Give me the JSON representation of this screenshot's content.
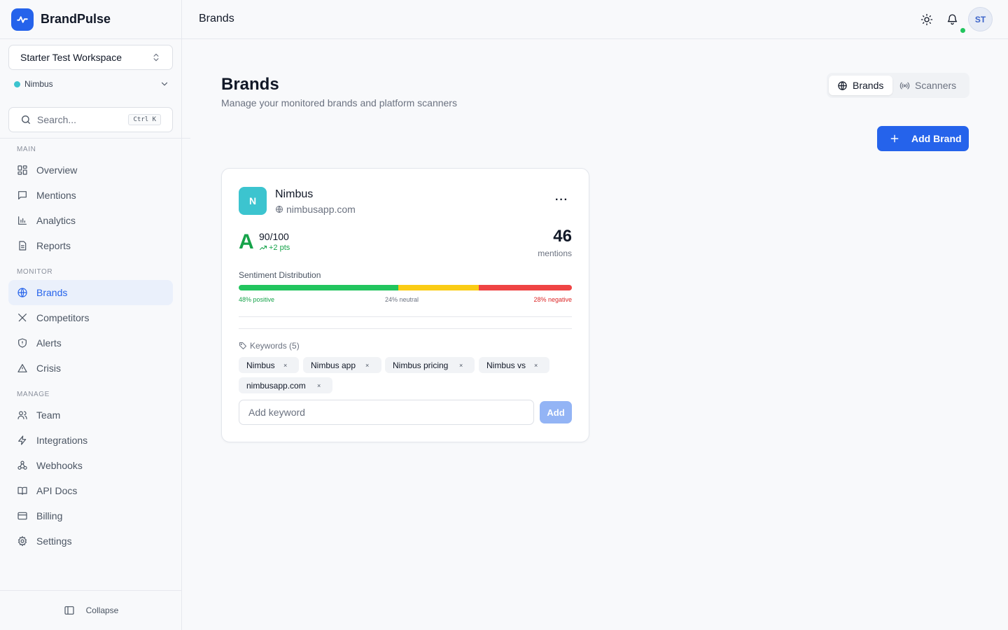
{
  "app": {
    "name": "BrandPulse"
  },
  "workspace": {
    "selected": "Starter Test Workspace"
  },
  "brand_selector": {
    "selected": "Nimbus",
    "dot_color": "#3cc4cf"
  },
  "search": {
    "placeholder": "Search...",
    "shortcut": "Ctrl K"
  },
  "sidebar": {
    "sections": {
      "main": "MAIN",
      "monitor": "MONITOR",
      "manage": "MANAGE"
    },
    "items": {
      "overview": "Overview",
      "mentions": "Mentions",
      "analytics": "Analytics",
      "reports": "Reports",
      "brands": "Brands",
      "competitors": "Competitors",
      "alerts": "Alerts",
      "crisis": "Crisis",
      "team": "Team",
      "integrations": "Integrations",
      "webhooks": "Webhooks",
      "api_docs": "API Docs",
      "billing": "Billing",
      "settings": "Settings"
    },
    "active": "brands",
    "collapse_label": "Collapse"
  },
  "header": {
    "breadcrumb": "Brands",
    "user_initials": "ST"
  },
  "page": {
    "title": "Brands",
    "subtitle": "Manage your monitored brands and platform scanners",
    "tabs": {
      "brands": "Brands",
      "scanners": "Scanners"
    },
    "add_brand_label": "Add Brand"
  },
  "brand_card": {
    "initial": "N",
    "name": "Nimbus",
    "domain": "nimbusapp.com",
    "grade": "A",
    "score": "90/100",
    "score_delta": "+2 pts",
    "mentions_count": "46",
    "mentions_label": "mentions",
    "sentiment_title": "Sentiment Distribution",
    "sentiment": {
      "positive_pct": 48,
      "neutral_pct": 24,
      "negative_pct": 28,
      "positive_label": "48% positive",
      "neutral_label": "24% neutral",
      "negative_label": "28% negative",
      "colors": {
        "positive": "#22c55e",
        "neutral": "#facc15",
        "negative": "#ef4444"
      }
    },
    "keywords_title": "Keywords (5)",
    "keywords": [
      "Nimbus",
      "Nimbus app",
      "Nimbus pricing",
      "Nimbus vs",
      "nimbusapp.com"
    ],
    "keyword_input_placeholder": "Add keyword",
    "keyword_add_label": "Add"
  },
  "colors": {
    "accent": "#2563eb",
    "grade": "#16a34a",
    "online": "#22c55e"
  }
}
